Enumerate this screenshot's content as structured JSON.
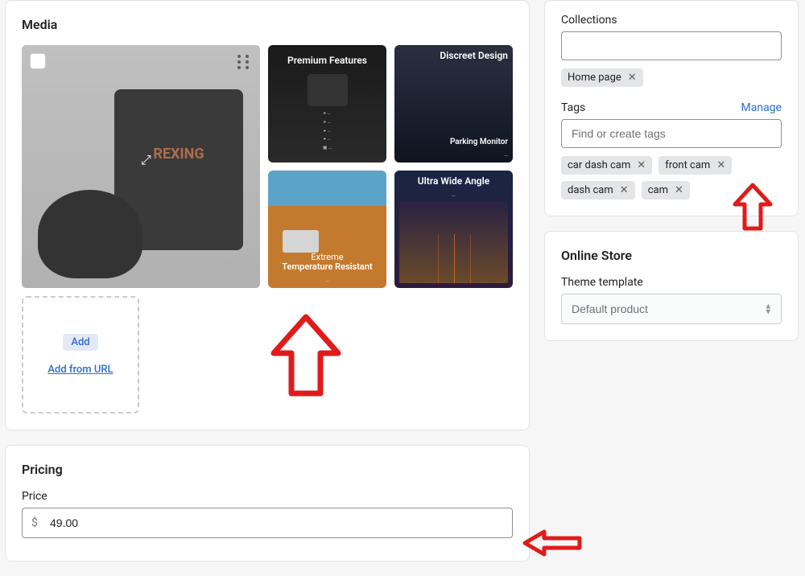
{
  "media": {
    "title": "Media",
    "main_brand": "REXING",
    "thumbs": [
      {
        "title": "Premium Features"
      },
      {
        "title": "Discreet Design",
        "sub1": "Parking Monitor"
      },
      {
        "title": "Extreme Temperature Resistant",
        "pre": ""
      },
      {
        "title": "Ultra Wide Angle"
      }
    ],
    "add_label": "Add",
    "add_url_label": "Add from URL"
  },
  "pricing": {
    "title": "Pricing",
    "price_label": "Price",
    "currency": "$",
    "price_value": "49.00"
  },
  "collections": {
    "label": "Collections",
    "chip": "Home page"
  },
  "tags": {
    "label": "Tags",
    "manage": "Manage",
    "placeholder": "Find or create tags",
    "items": [
      "car dash cam",
      "front cam",
      "dash cam",
      "cam"
    ]
  },
  "online_store": {
    "title": "Online Store",
    "template_label": "Theme template",
    "template_value": "Default product"
  }
}
